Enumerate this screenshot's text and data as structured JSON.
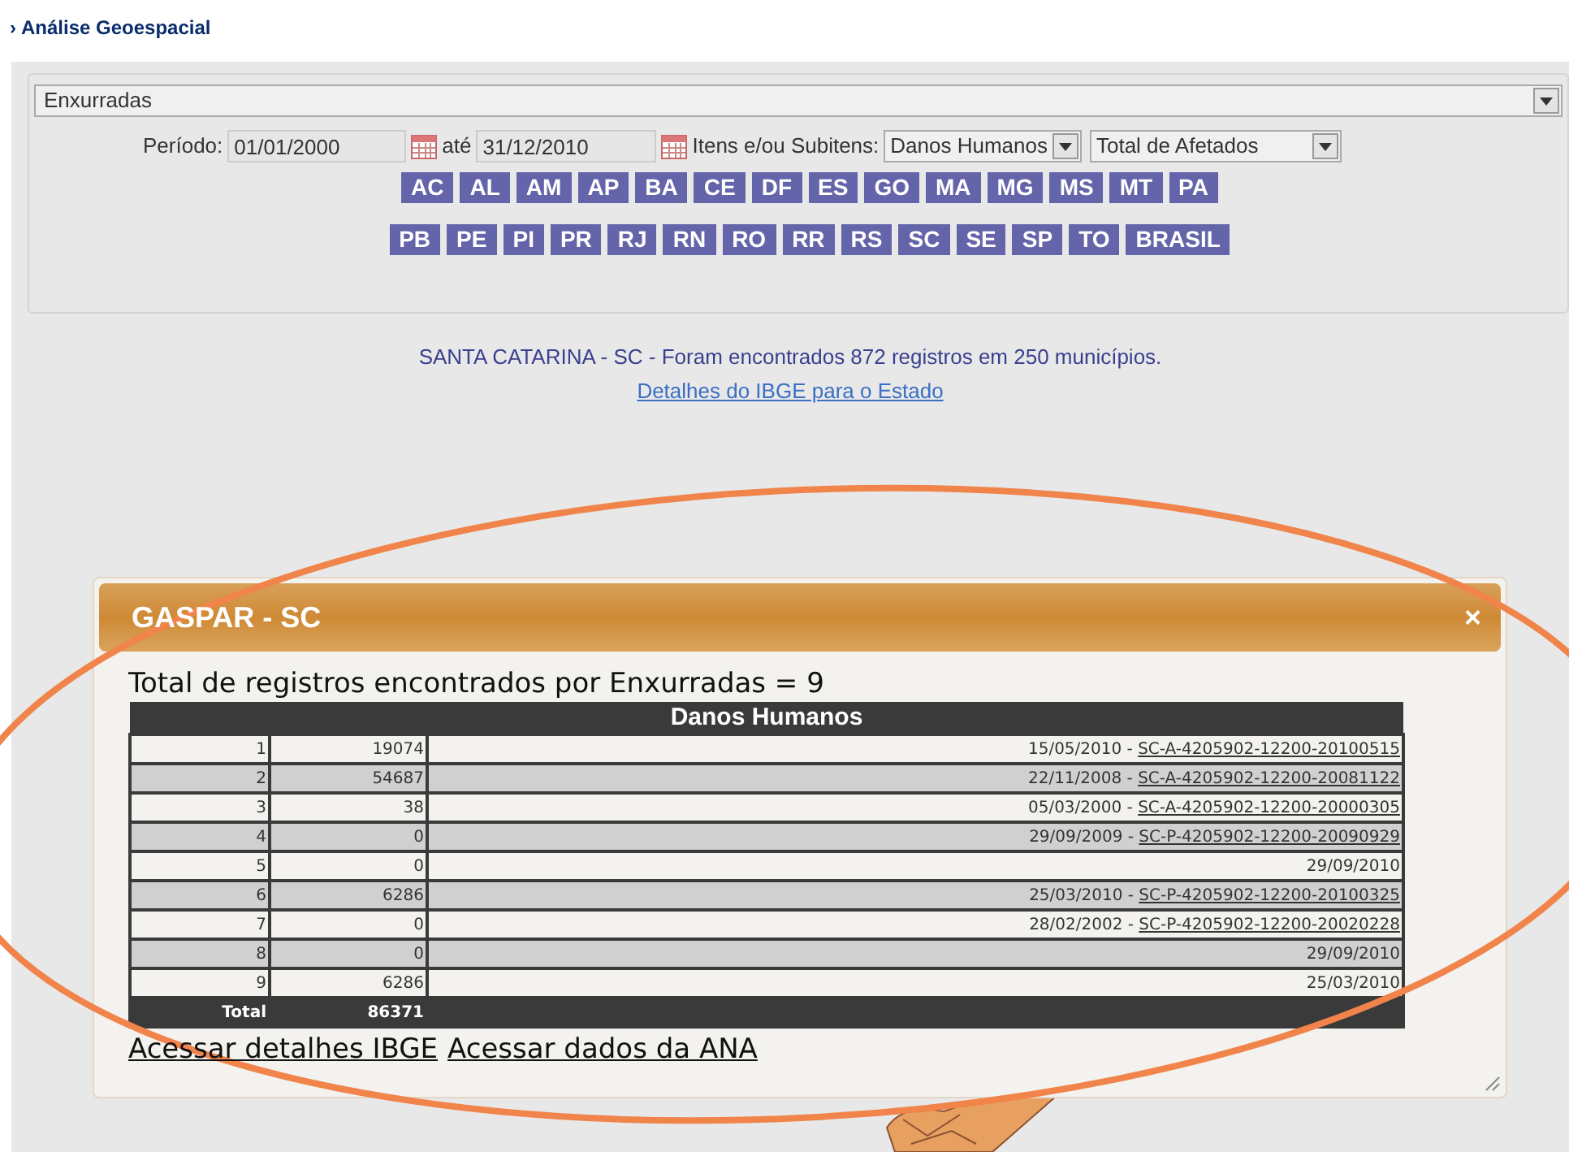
{
  "breadcrumb": {
    "marker": "›",
    "label": "Análise Geoespacial"
  },
  "filters": {
    "disaster_select": "Enxurradas",
    "period_label": "Período:",
    "start_date": "01/01/2000",
    "until_label": "até",
    "end_date": "31/12/2010",
    "items_label": "Itens e/ou Subitens:",
    "item_select": "Danos Humanos",
    "subitem_select": "Total de Afetados"
  },
  "state_buttons": [
    [
      "AC",
      "AL",
      "AM",
      "AP",
      "BA",
      "CE",
      "DF",
      "ES",
      "GO",
      "MA",
      "MG",
      "MS",
      "MT",
      "PA"
    ],
    [
      "PB",
      "PE",
      "PI",
      "PR",
      "RJ",
      "RN",
      "RO",
      "RR",
      "RS",
      "SC",
      "SE",
      "SP",
      "TO",
      "BRASIL"
    ]
  ],
  "summary": {
    "text": "SANTA CATARINA - SC - Foram encontrados 872 registros em 250 municípios.",
    "link": "Detalhes do IBGE para o Estado"
  },
  "dialog": {
    "title": "GASPAR - SC",
    "close": "×",
    "heading": "Total de registros encontrados por Enxurradas = 9",
    "table_title": "Danos Humanos",
    "rows": [
      {
        "number": "1",
        "value": "19074",
        "date": "15/05/2010 - ",
        "code": "SC-A-4205902-12200-20100515"
      },
      {
        "number": "2",
        "value": "54687",
        "date": "22/11/2008 - ",
        "code": "SC-A-4205902-12200-20081122"
      },
      {
        "number": "3",
        "value": "38",
        "date": "05/03/2000 - ",
        "code": "SC-A-4205902-12200-20000305"
      },
      {
        "number": "4",
        "value": "0",
        "date": "29/09/2009 - ",
        "code": "SC-P-4205902-12200-20090929"
      },
      {
        "number": "5",
        "value": "0",
        "date": "29/09/2010"
      },
      {
        "number": "6",
        "value": "6286",
        "date": "25/03/2010 - ",
        "code": "SC-P-4205902-12200-20100325"
      },
      {
        "number": "7",
        "value": "0",
        "date": "28/02/2002 - ",
        "code": "SC-P-4205902-12200-20020228"
      },
      {
        "number": "8",
        "value": "0",
        "date": "29/09/2010"
      },
      {
        "number": "9",
        "value": "6286",
        "date": "25/03/2010"
      }
    ],
    "total_label": "Total",
    "total_value": "86371",
    "links": [
      "Acessar detalhes IBGE",
      "Acessar dados da ANA"
    ]
  }
}
